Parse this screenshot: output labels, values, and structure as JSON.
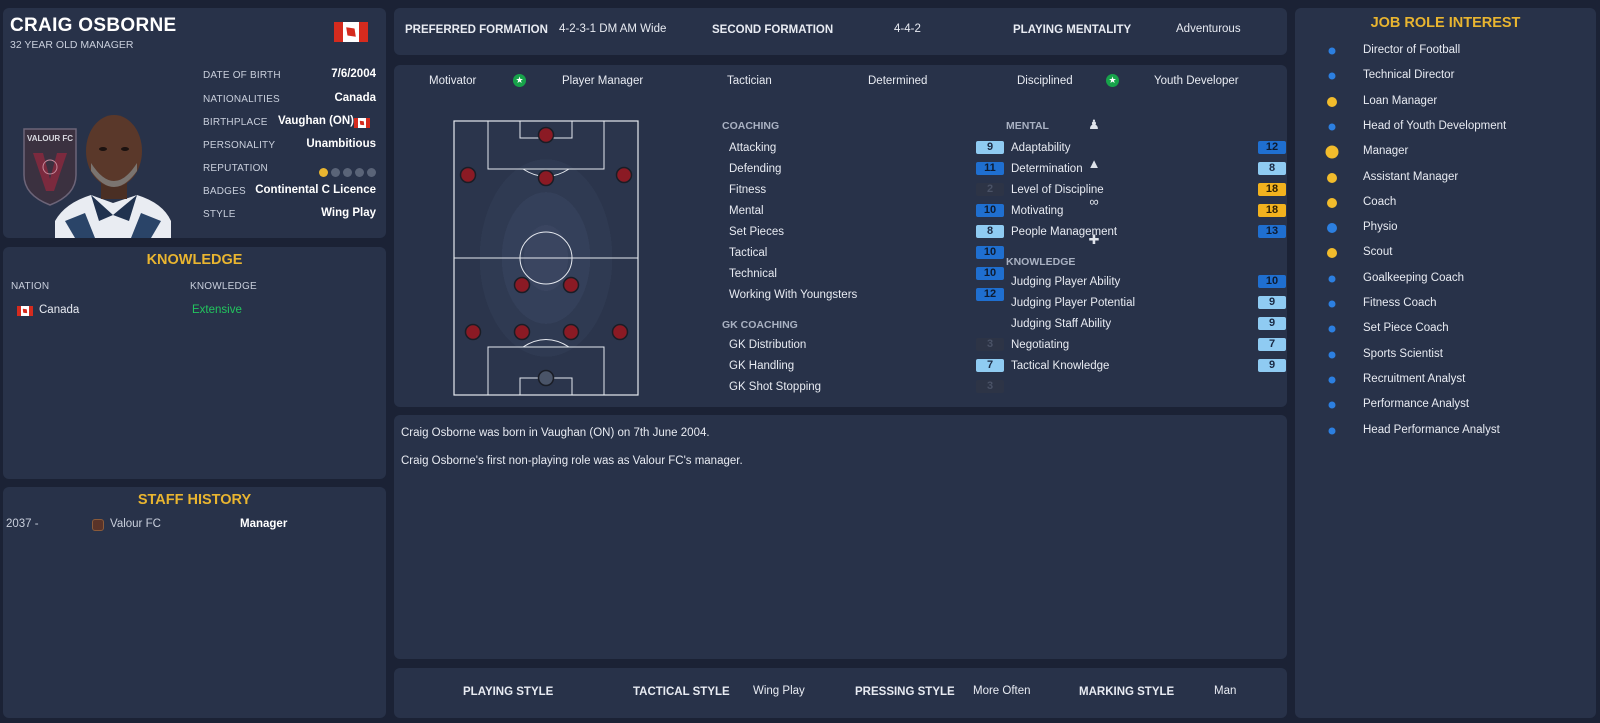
{
  "profile": {
    "name": "CRAIG OSBORNE",
    "subtitle": "32 YEAR OLD MANAGER",
    "info": [
      {
        "label": "DATE OF BIRTH",
        "value": "7/6/2004"
      },
      {
        "label": "NATIONALITIES",
        "value": "Canada"
      },
      {
        "label": "BIRTHPLACE",
        "value": "Vaughan (ON)"
      },
      {
        "label": "PERSONALITY",
        "value": "Unambitious"
      },
      {
        "label": "REPUTATION",
        "value": ""
      },
      {
        "label": "BADGES",
        "value": "Continental C Licence"
      },
      {
        "label": "STYLE",
        "value": "Wing Play"
      }
    ],
    "reputation_stars": 1,
    "reputation_max": 5,
    "club_badge_text": "VALOUR FC"
  },
  "knowledge": {
    "title": "KNOWLEDGE",
    "col_nation": "NATION",
    "col_knowledge": "KNOWLEDGE",
    "rows": [
      {
        "nation": "Canada",
        "level": "Extensive"
      }
    ],
    "level_color": "#22c55e"
  },
  "history": {
    "title": "STAFF HISTORY",
    "rows": [
      {
        "years": "2037 -",
        "club": "Valour FC",
        "role": "Manager"
      }
    ]
  },
  "formation": {
    "preferred_label": "PREFERRED FORMATION",
    "preferred_value": "4-2-3-1 DM AM Wide",
    "second_label": "SECOND FORMATION",
    "second_value": "4-4-2",
    "mentality_label": "PLAYING MENTALITY",
    "mentality_value": "Adventurous"
  },
  "traits": [
    {
      "label": "Motivator",
      "star": true
    },
    {
      "label": "Player Manager",
      "star": false
    },
    {
      "label": "Tactician",
      "star": false
    },
    {
      "label": "Determined",
      "star": false
    },
    {
      "label": "Disciplined",
      "star": true
    },
    {
      "label": "Youth Developer",
      "star": false
    }
  ],
  "coaching": {
    "title": "COACHING",
    "items": [
      {
        "name": "Attacking",
        "value": "9"
      },
      {
        "name": "Defending",
        "value": "11"
      },
      {
        "name": "Fitness",
        "value": "2"
      },
      {
        "name": "Mental",
        "value": "10"
      },
      {
        "name": "Set Pieces",
        "value": "8"
      },
      {
        "name": "Tactical",
        "value": "10"
      },
      {
        "name": "Technical",
        "value": "10"
      },
      {
        "name": "Working With Youngsters",
        "value": "12"
      }
    ]
  },
  "gk_coaching": {
    "title": "GK COACHING",
    "items": [
      {
        "name": "GK Distribution",
        "value": "3"
      },
      {
        "name": "GK Handling",
        "value": "7"
      },
      {
        "name": "GK Shot Stopping",
        "value": "3"
      }
    ]
  },
  "mental": {
    "title": "MENTAL",
    "items": [
      {
        "name": "Adaptability",
        "value": "12"
      },
      {
        "name": "Determination",
        "value": "8"
      },
      {
        "name": "Level of Discipline",
        "value": "18"
      },
      {
        "name": "Motivating",
        "value": "18"
      },
      {
        "name": "People Management",
        "value": "13"
      }
    ]
  },
  "knowledge_attrs": {
    "title": "KNOWLEDGE",
    "items": [
      {
        "name": "Judging Player Ability",
        "value": "10"
      },
      {
        "name": "Judging Player Potential",
        "value": "9"
      },
      {
        "name": "Judging Staff Ability",
        "value": "9"
      },
      {
        "name": "Negotiating",
        "value": "7"
      },
      {
        "name": "Tactical Knowledge",
        "value": "9"
      }
    ]
  },
  "bio": [
    "Craig Osborne was born in Vaughan (ON) on 7th June 2004.",
    "Craig Osborne's first non-playing role was as Valour FC's manager."
  ],
  "styles": {
    "playing_label": "PLAYING STYLE",
    "playing_value": "",
    "tactical_label": "TACTICAL STYLE",
    "tactical_value": "Wing Play",
    "pressing_label": "PRESSING STYLE",
    "pressing_value": "More Often",
    "marking_label": "MARKING STYLE",
    "marking_value": "Man"
  },
  "job_roles": {
    "title": "JOB ROLE INTEREST",
    "items": [
      {
        "label": "Director of Football",
        "level": "low"
      },
      {
        "label": "Technical Director",
        "level": "low"
      },
      {
        "label": "Loan Manager",
        "level": "medium"
      },
      {
        "label": "Head of Youth Development",
        "level": "low"
      },
      {
        "label": "Manager",
        "level": "high"
      },
      {
        "label": "Assistant Manager",
        "level": "medium"
      },
      {
        "label": "Coach",
        "level": "medium"
      },
      {
        "label": "Physio",
        "level": "medium-blue"
      },
      {
        "label": "Scout",
        "level": "medium"
      },
      {
        "label": "Goalkeeping Coach",
        "level": "low"
      },
      {
        "label": "Fitness Coach",
        "level": "low"
      },
      {
        "label": "Set Piece Coach",
        "level": "low"
      },
      {
        "label": "Sports Scientist",
        "level": "low"
      },
      {
        "label": "Recruitment Analyst",
        "level": "low"
      },
      {
        "label": "Performance Analyst",
        "level": "low"
      },
      {
        "label": "Head Performance Analyst",
        "level": "low"
      }
    ]
  },
  "colors": {
    "background": "#1b2235",
    "panel": "#283249",
    "gold": "#e9b530",
    "attr_low": "#2d3446",
    "attr_mid_dark": "#1f6fd0",
    "attr_mid_light": "#8fcbf2",
    "attr_high": "#f2b21e",
    "player_dot": "#8b1a24",
    "gk_dot": "#4a5468",
    "job_blue": "#2c7fe0",
    "job_gold": "#f2bc2c"
  }
}
